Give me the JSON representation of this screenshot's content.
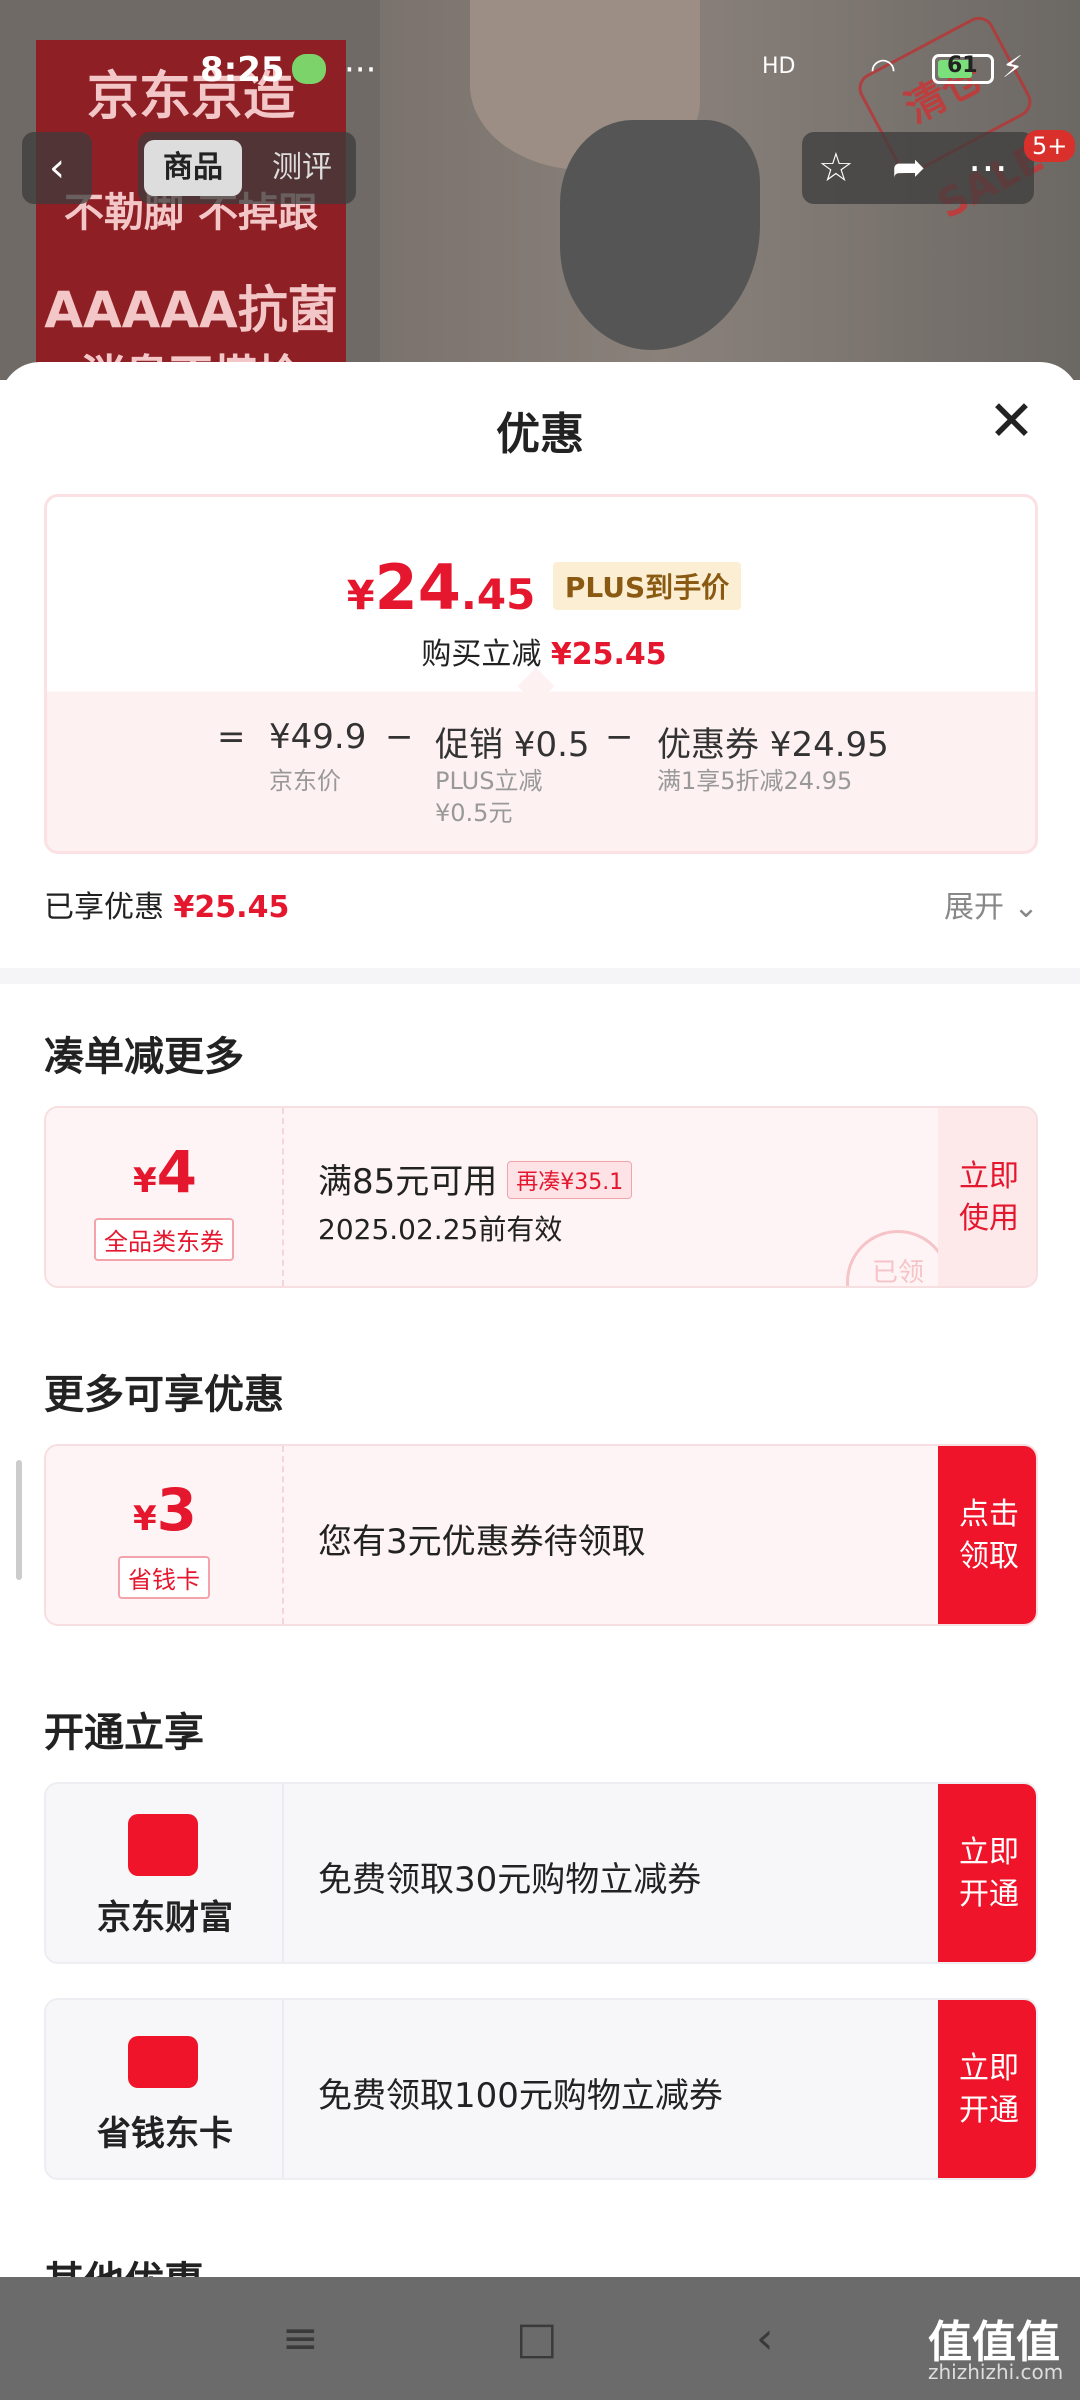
{
  "status_bar": {
    "time": "8:25",
    "more": "···",
    "network": "HD",
    "battery": "61"
  },
  "background": {
    "poster_lines": [
      "京东京造",
      "不勒脚 不掉跟",
      "AAAAA抗菌",
      "消臭不搭检"
    ],
    "sale_tag": "清仓 SALE"
  },
  "top_nav": {
    "tab_active": "商品",
    "tab_inactive": "测评",
    "badge": "5+"
  },
  "sheet": {
    "title": "优惠",
    "price_box": {
      "currency": "¥",
      "price_int": "24",
      "price_dec": ".45",
      "plus_tag": "PLUS到手价",
      "discount_label": "购买立减",
      "discount_value": "¥25.45",
      "eq_sign": "=",
      "minus": "−",
      "jd_price": "¥49.9",
      "jd_price_label": "京东价",
      "promo": "促销 ¥0.5",
      "promo_detail_1": "PLUS立减",
      "promo_detail_2": "¥0.5元",
      "coupon": "优惠券 ¥24.95",
      "coupon_detail": "满1享5折减24.95"
    },
    "enjoyed_label": "已享优惠",
    "enjoyed_value": "¥25.45",
    "expand": "展开 ⌄",
    "section_1": {
      "heading": "凑单减更多",
      "card": {
        "currency": "¥",
        "amount": "4",
        "tag": "全品类东券",
        "title": "满85元可用",
        "extra": "再凑¥35.1",
        "validity": "2025.02.25前有效",
        "button_line1": "立即",
        "button_line2": "使用",
        "stamp": "已领"
      }
    },
    "section_2": {
      "heading": "更多可享优惠",
      "card": {
        "currency": "¥",
        "amount": "3",
        "tag": "省钱卡",
        "text": "您有3元优惠券待领取",
        "button_line1": "点击",
        "button_line2": "领取"
      }
    },
    "section_3": {
      "heading": "开通立享",
      "cards": [
        {
          "name": "京东财富",
          "text": "免费领取30元购物立减券",
          "button_line1": "立即",
          "button_line2": "开通"
        },
        {
          "name": "省钱东卡",
          "text": "免费领取100元购物立减券",
          "button_line1": "立即",
          "button_line2": "开通"
        }
      ]
    },
    "section_4_heading_partial": "其他优惠"
  },
  "watermark": {
    "main": "值值值",
    "sub": "zhizhizhi.com"
  },
  "colors": {
    "accent_red": "#e5172e",
    "button_red": "#f0142a",
    "plus_gold": "#8a5a12"
  }
}
